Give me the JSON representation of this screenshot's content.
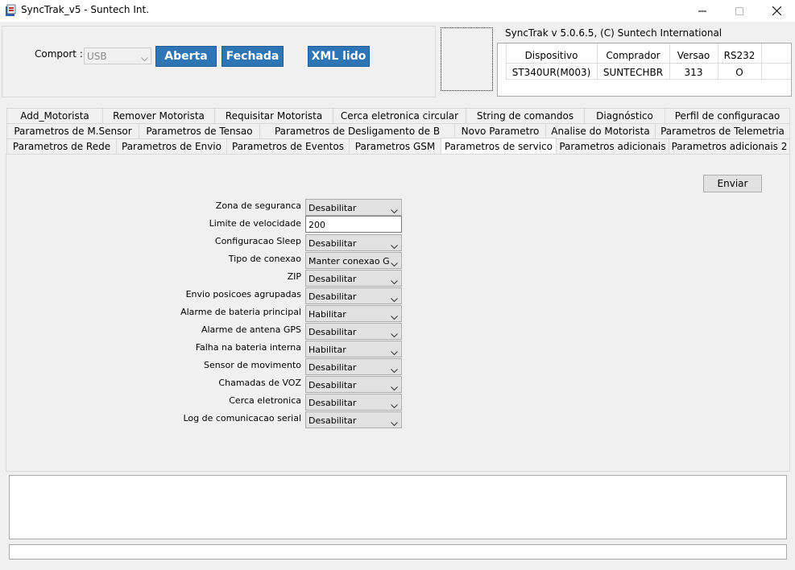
{
  "window": {
    "title": "SyncTrak_v5 - Suntech Int."
  },
  "comport": {
    "label": "Comport :",
    "value": "USB"
  },
  "buttons": {
    "aberta": "Aberta",
    "fechada": "Fechada",
    "xml_lido": "XML lido",
    "enviar": "Enviar"
  },
  "version_text": "SyncTrak v 5.0.6.5, (C) Suntech International",
  "device_table": {
    "headers": [
      "Dispositivo",
      "Comprador",
      "Versao",
      "RS232"
    ],
    "values": [
      "ST340UR(M003)",
      "SUNTECHBR",
      "313",
      "O"
    ]
  },
  "tabs": {
    "row1": [
      "Add_Motorista",
      "Remover Motorista",
      "Requisitar Motorista",
      "Cerca eletronica circular",
      "String de comandos",
      "Diagnóstico",
      "Perfil de configuracao"
    ],
    "row2": [
      "Parametros  de M.Sensor",
      "Parametros de Tensao",
      "Parametros de Desligamento de B",
      "Novo Parametro",
      "Analise do Motorista",
      "Parametros de Telemetria"
    ],
    "row3": [
      "Parametros de Rede",
      "Parametros de Envio",
      "Parametros de Eventos",
      "Parametros GSM",
      "Parametros de servico",
      "Parametros adicionais",
      "Parametros adicionais 2"
    ],
    "active": "Parametros de servico"
  },
  "fields": [
    {
      "label": "Zona de seguranca",
      "value": "Desabilitar",
      "type": "select"
    },
    {
      "label": "Limite de velocidade",
      "value": "200",
      "type": "text"
    },
    {
      "label": "Configuracao Sleep",
      "value": "Desabilitar",
      "type": "select"
    },
    {
      "label": "Tipo de conexao",
      "value": "Manter conexao GP",
      "type": "select"
    },
    {
      "label": "ZIP",
      "value": "Desabilitar",
      "type": "select"
    },
    {
      "label": "Envio posicoes agrupadas",
      "value": "Desabilitar",
      "type": "select"
    },
    {
      "label": "Alarme de bateria principal",
      "value": "Habilitar",
      "type": "select"
    },
    {
      "label": "Alarme de antena GPS",
      "value": "Desabilitar",
      "type": "select"
    },
    {
      "label": "Falha na bateria interna",
      "value": "Habilitar",
      "type": "select"
    },
    {
      "label": "Sensor de movimento",
      "value": "Desabilitar",
      "type": "select"
    },
    {
      "label": "Chamadas de VOZ",
      "value": "Desabilitar",
      "type": "select"
    },
    {
      "label": "Cerca eletronica",
      "value": "Desabilitar",
      "type": "select"
    },
    {
      "label": "Log de comunicacao serial",
      "value": "Desabilitar",
      "type": "select"
    }
  ],
  "icons": {
    "app": "app-icon",
    "minimize": "minimize-icon",
    "maximize": "maximize-icon",
    "close": "close-icon",
    "dropdown": "chevron-down-icon"
  }
}
